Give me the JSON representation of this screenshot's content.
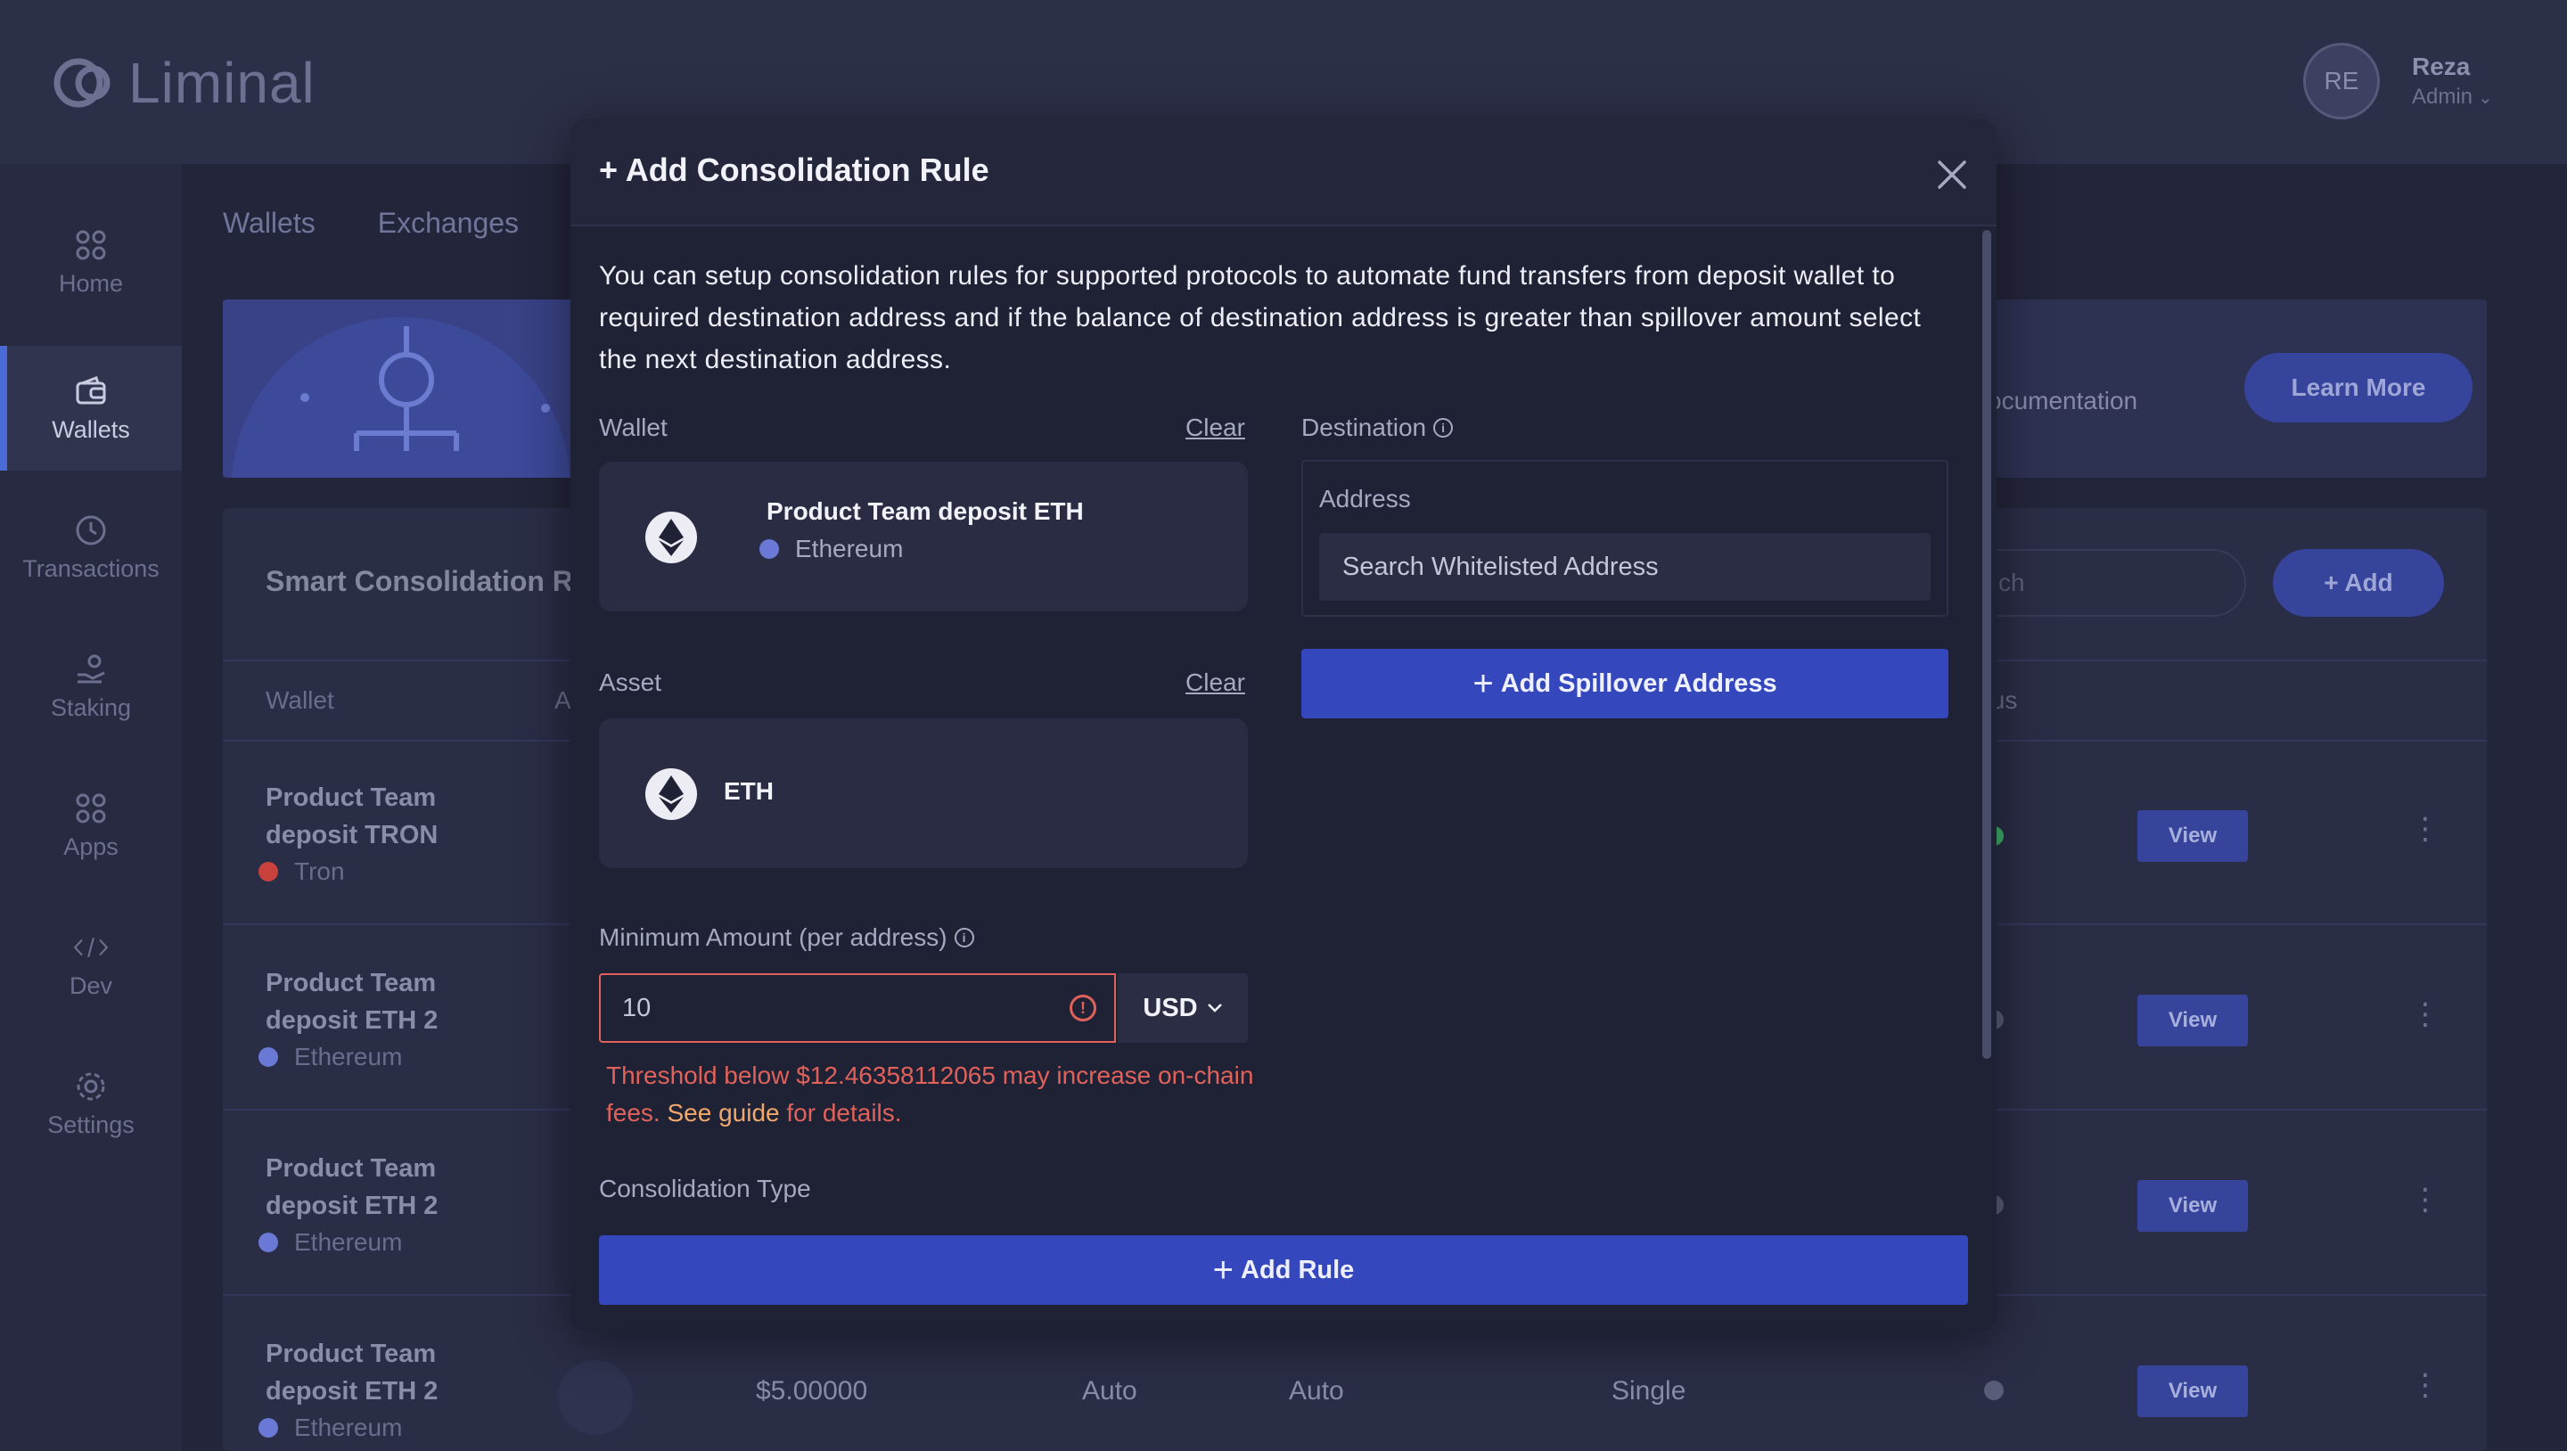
{
  "app": {
    "logo_text": "Liminal",
    "user": {
      "initials": "RE",
      "name": "Reza",
      "role": "Admin"
    }
  },
  "sidebar": {
    "items": [
      {
        "label": "Home",
        "icon": "grid-icon"
      },
      {
        "label": "Wallets",
        "icon": "wallet-icon"
      },
      {
        "label": "Transactions",
        "icon": "clock-icon"
      },
      {
        "label": "Staking",
        "icon": "staking-icon"
      },
      {
        "label": "Apps",
        "icon": "grid-icon"
      },
      {
        "label": "Dev",
        "icon": "code-icon"
      },
      {
        "label": "Settings",
        "icon": "gear-icon"
      }
    ]
  },
  "tabs": [
    "Wallets",
    "Exchanges"
  ],
  "banner": {
    "doc_text": "ocumentation",
    "learn_more": "Learn More"
  },
  "panel": {
    "title": "Smart Consolidation R",
    "search_placeholder": "ch",
    "add_label": "+ Add",
    "columns": {
      "wallet": "Wallet",
      "a": "A",
      "status": "tus"
    },
    "rows": [
      {
        "name_1": "Product Team",
        "name_2": "deposit TRON",
        "chain": "Tron",
        "chain_color": "#c9413c",
        "status_color": "#3fae6b"
      },
      {
        "name_1": "Product Team",
        "name_2": "deposit ETH 2",
        "chain": "Ethereum",
        "chain_color": "#6a78d6",
        "status_color": "#5a5d7a"
      },
      {
        "name_1": "Product Team",
        "name_2": "deposit ETH 2",
        "chain": "Ethereum",
        "chain_color": "#6a78d6",
        "status_color": "#5a5d7a"
      },
      {
        "name_1": "Product Team",
        "name_2": "deposit ETH 2",
        "chain": "Ethereum",
        "chain_color": "#6a78d6",
        "status_color": "#5a5d7a",
        "amount": "$5.00000",
        "col_b": "Auto",
        "col_c": "Auto",
        "col_d": "Single"
      }
    ],
    "view_label": "View"
  },
  "modal": {
    "title": "+ Add Consolidation Rule",
    "intro": "You can setup consolidation rules for supported protocols to automate fund transfers from deposit wallet to required destination address and if the balance of destination address is greater than spillover amount select the next destination address.",
    "wallet_label": "Wallet",
    "clear_label": "Clear",
    "selected_wallet": {
      "name": "Product Team deposit ETH",
      "chain": "Ethereum",
      "chain_color": "#6a78d6"
    },
    "asset_label": "Asset",
    "selected_asset": "ETH",
    "destination_label": "Destination",
    "address_label": "Address",
    "address_placeholder": "Search Whitelisted Address",
    "spillover_button": "Add Spillover Address",
    "min_amount_label": "Minimum Amount (per address)",
    "min_amount_value": "10",
    "currency": "USD",
    "error_pre": "Threshold below $12.46358112065 may increase on-chain fees.",
    "error_link": "See guide",
    "error_post": "for details.",
    "consolidation_type_label": "Consolidation Type",
    "add_rule_button": "Add Rule"
  },
  "colors": {
    "accent": "#3547bd",
    "error": "#e0625a",
    "modal_bg": "#1f2135"
  }
}
